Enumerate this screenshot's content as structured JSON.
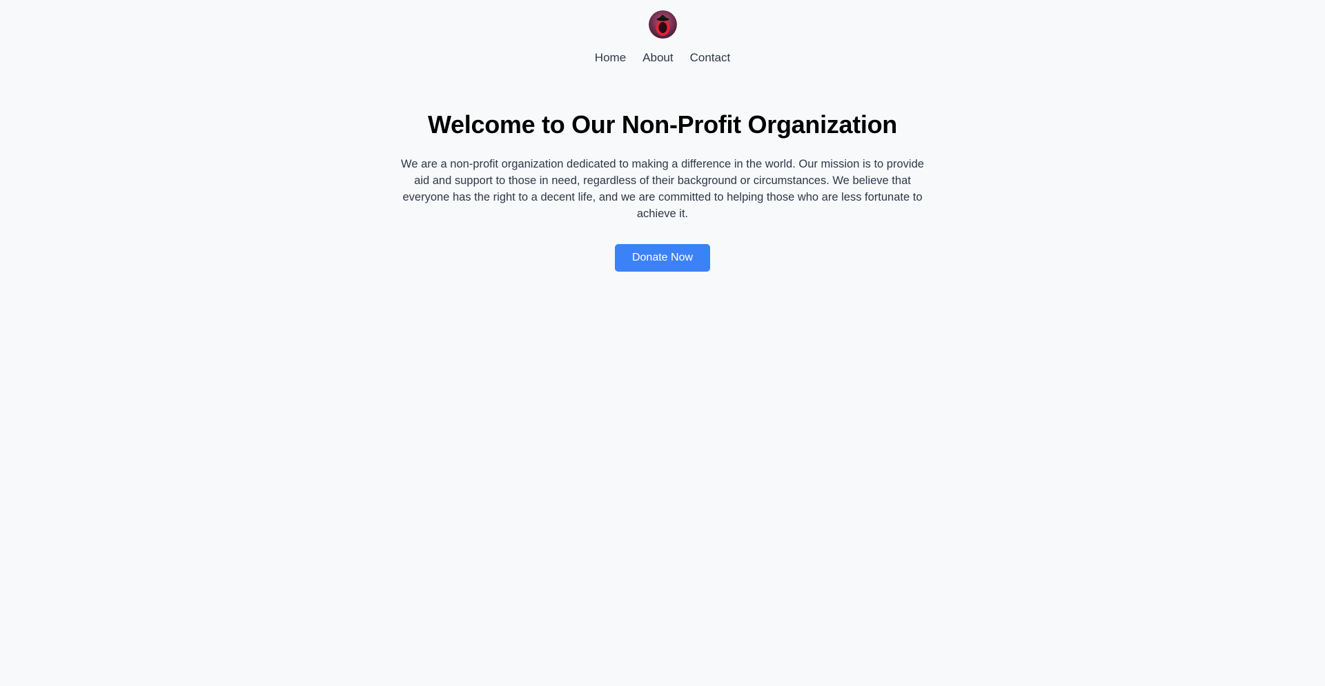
{
  "header": {
    "logo_icon": "circular-avatar-logo",
    "nav": [
      "Home",
      "About",
      "Contact"
    ]
  },
  "hero": {
    "title": "Welcome to Our Non-Profit Organization",
    "description": "We are a non-profit organization dedicated to making a difference in the world. Our mission is to provide aid and support to those in need, regardless of their background or circumstances. We believe that everyone has the right to a decent life, and we are committed to helping those who are less fortunate to achieve it.",
    "cta_label": "Donate Now"
  },
  "colors": {
    "background": "#f8f9fb",
    "accent": "#3b82f6",
    "text": "#2d3748",
    "heading": "#000000"
  }
}
